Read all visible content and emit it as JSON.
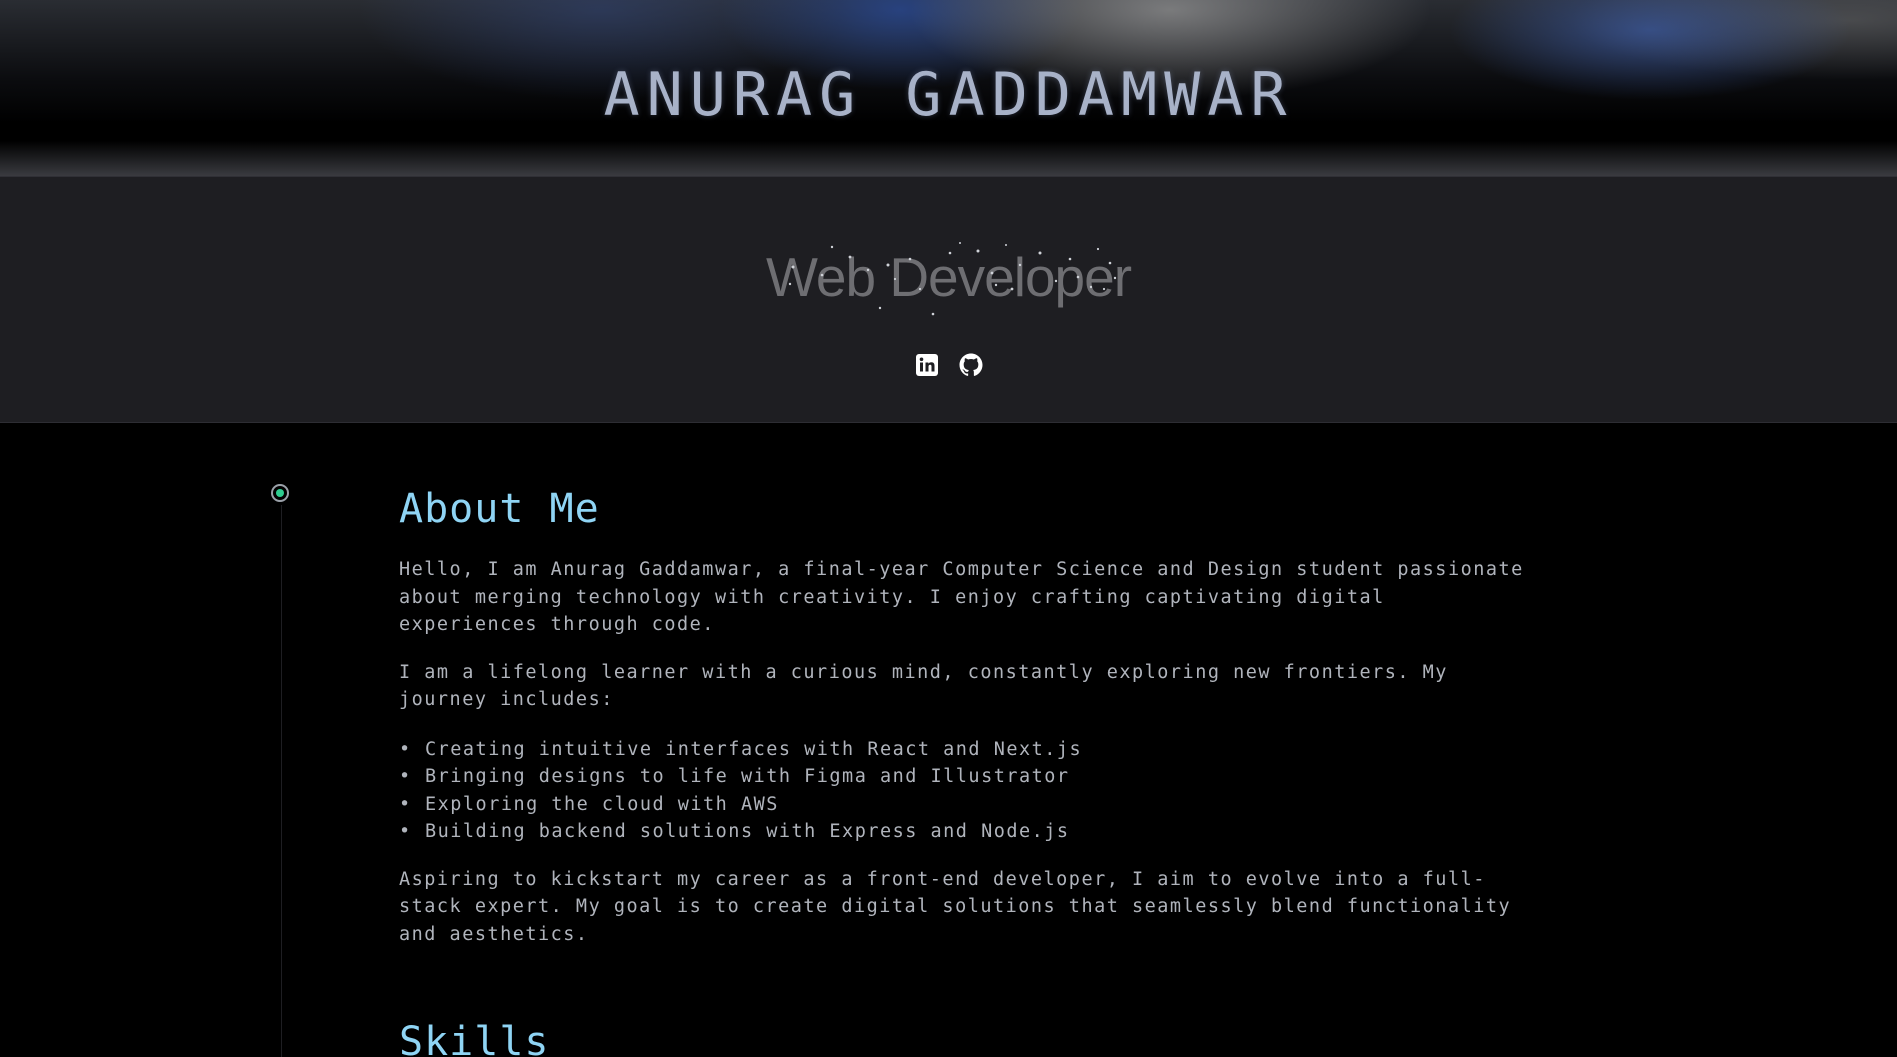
{
  "header": {
    "name": "ANURAG GADDAMWAR"
  },
  "hero": {
    "subtitle": "Web Developer",
    "social": [
      {
        "name": "linkedin-icon"
      },
      {
        "name": "github-icon"
      }
    ]
  },
  "about": {
    "heading": "About Me",
    "intro": "Hello, I am Anurag Gaddamwar, a final-year Computer Science and Design student passionate about merging technology with creativity. I enjoy crafting captivating digital experiences through code.",
    "journey_intro": "I am a lifelong learner with a curious mind, constantly exploring new frontiers. My journey includes:",
    "journey_items": [
      "Creating intuitive interfaces with React and Next.js",
      "Bringing designs to life with Figma and Illustrator",
      "Exploring the cloud with AWS",
      "Building backend solutions with Express and Node.js"
    ],
    "closing": "Aspiring to kickstart my career as a front-end developer, I aim to evolve into a full-stack expert. My goal is to create digital solutions that seamlessly blend functionality and aesthetics."
  },
  "skills": {
    "heading": "Skills"
  },
  "colors": {
    "accent": "#8fd4f4",
    "timeline_dot": "#2ecc8f",
    "body_text": "#b0b4bc",
    "hero_bg": "#1e1e22"
  }
}
